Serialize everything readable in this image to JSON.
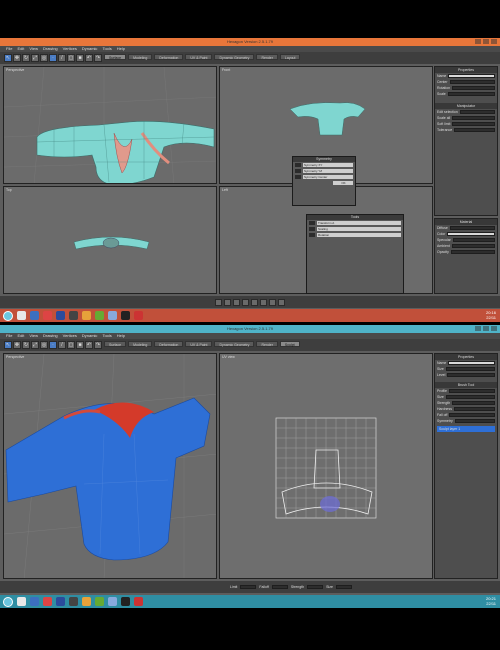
{
  "window_title": "Hexagon Version 2.5.1.79",
  "menu": [
    "File",
    "Edit",
    "View",
    "Drawing",
    "Vertices",
    "Dynamic",
    "Tools",
    "Help"
  ],
  "tabs_top": [
    "Surface",
    "Modeling",
    "Deformation",
    "UV & Paint",
    "Dynamic Geometry",
    "Render",
    "Layout"
  ],
  "tabs_bottom": [
    "Surface",
    "Modeling",
    "Deformation",
    "UV & Paint",
    "Dynamic Geometry",
    "Render",
    "Sculpt"
  ],
  "viewports_top": [
    "Perspective",
    "Front",
    "Top",
    "Left"
  ],
  "viewports_bottom": [
    "Perspective",
    "UV view"
  ],
  "panel_top": {
    "title": "Properties",
    "rows": [
      "Name",
      "Center",
      "Rotation",
      "Scale"
    ],
    "section": "Manipulator",
    "rows2": [
      "Edit selection",
      "Scale all",
      "Soft limit",
      "Tolerance"
    ]
  },
  "panel_top2": {
    "title": "Material",
    "rows": [
      "Diffuse",
      "Color",
      "Specular",
      "Ambient",
      "Opacity"
    ]
  },
  "dialog": {
    "title": "Symmetry",
    "rows": [
      "Symmetry XY",
      "Symmetry YZ",
      "Symmetry Center"
    ],
    "ok": "OK"
  },
  "dialog2": {
    "title": "Tools",
    "rows": [
      "Transform A",
      "Scaling",
      "Rotation"
    ]
  },
  "panel_bottom": {
    "title": "Properties",
    "rows": [
      "Name",
      "Size",
      "Level"
    ],
    "tool": "Brush Tool",
    "rows2": [
      "Profile",
      "Size",
      "Strength",
      "Hardness",
      "Fall off"
    ],
    "symmetry": "Symmetry",
    "selected": "Sculpt layer 1"
  },
  "bottom_controls": [
    "Limit",
    "Falloff",
    "Strength",
    "Size"
  ],
  "tray_time_top": "20:16",
  "tray_date_top": "22/11",
  "tray_time_bottom": "20:21",
  "tray_date_bottom": "22/11",
  "colors": {
    "orange_frame": "#e8763a",
    "teal_frame": "#4fb3c8",
    "mesh_cyan": "#7fd6d0",
    "sculpt_blue": "#2e6fd6"
  }
}
